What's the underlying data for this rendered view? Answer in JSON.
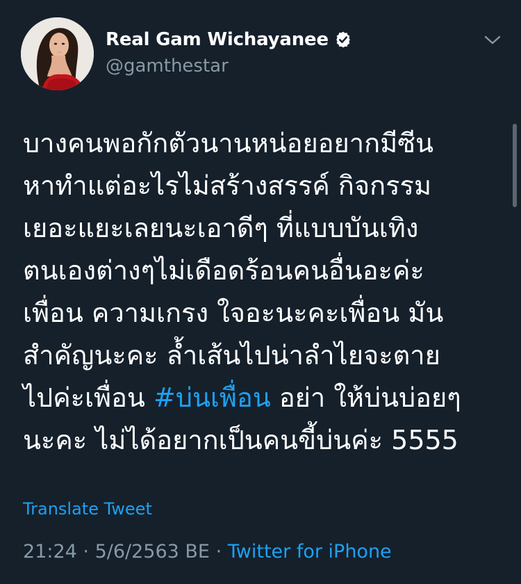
{
  "user": {
    "display_name": "Real Gam Wichayanee",
    "handle": "@gamthestar",
    "verified": true,
    "avatar_icon": "profile-photo"
  },
  "tweet": {
    "lines": [
      "บางคนพอกักตัวนานหน่อยอยากมีซีน",
      "หาทำแต่อะไรไม่สร้างสรรค์ กิจกรรม",
      "เยอะแยะเลยนะเอาดีๆ ที่แบบบันเทิง",
      "ตนเองต่างๆไม่เดือดร้อนคนอื่นอะค่ะ",
      "เพื่อน ความเกรง ใจอะนะคะเพื่อน มัน",
      "สำคัญนะคะ ล้ำเส้นไปน่าลำไยจะตาย",
      "ไปค่ะเพื่อน ",
      "นะคะ ไม่ได้อยากเป็นคนขี้บ่นค่ะ 5555"
    ],
    "hashtag": "#บ่นเพื่อน",
    "after_hashtag": " อย่า ให้บ่นบ่อยๆ"
  },
  "actions": {
    "translate_label": "Translate Tweet",
    "menu_icon": "chevron-down-icon"
  },
  "meta": {
    "time": "21:24",
    "separator": " · ",
    "date": "5/6/2563 BE",
    "source": "Twitter for iPhone"
  },
  "colors": {
    "background": "#15202b",
    "primary_text": "#ffffff",
    "secondary_text": "#8899a6",
    "accent": "#1da1f2"
  }
}
